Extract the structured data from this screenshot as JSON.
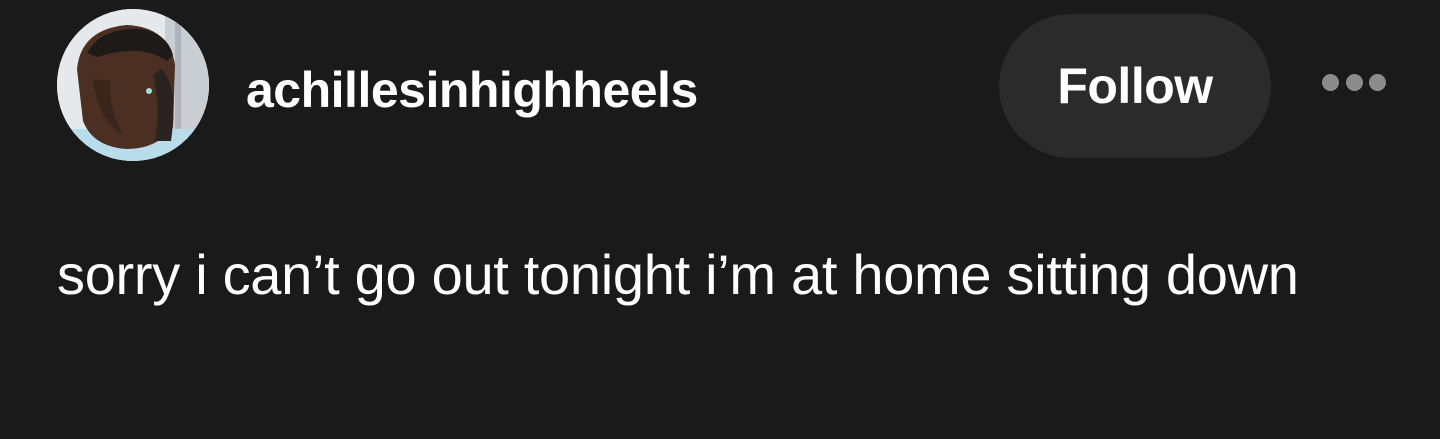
{
  "post": {
    "author": {
      "username": "achillesinhighheels",
      "avatar_icon": "user-avatar-photo"
    },
    "follow_label": "Follow",
    "more_icon": "more-options-icon",
    "body_text": "sorry i can’t go out tonight i’m at home sitting down"
  },
  "colors": {
    "background": "#1a1a1a",
    "text": "#ffffff",
    "follow_button_bg": "#2b2b2b",
    "more_dots": "#8c8c8c"
  }
}
